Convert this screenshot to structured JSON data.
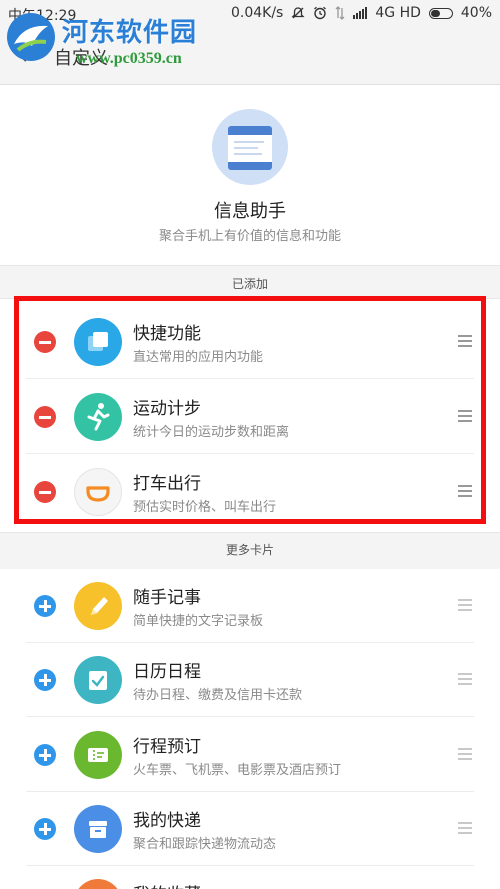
{
  "statusbar": {
    "time": "中午12:29",
    "speed": "0.04K/s",
    "network": "4G HD",
    "battery": "40%"
  },
  "watermark": {
    "name": "河东软件园",
    "url": "www.pc0359.cn"
  },
  "header": {
    "back_icon": "chevron-left-icon",
    "title": "自定义"
  },
  "hero": {
    "title": "信息助手",
    "subtitle": "聚合手机上有价值的信息和功能"
  },
  "sections": {
    "added": "已添加",
    "more": "更多卡片"
  },
  "added_items": [
    {
      "name": "快捷功能",
      "desc": "直达常用的应用内功能",
      "icon": "shortcut-icon",
      "color": "#2aa7e6"
    },
    {
      "name": "运动计步",
      "desc": "统计今日的运动步数和距离",
      "icon": "running-icon",
      "color": "#33c3a4"
    },
    {
      "name": "打车出行",
      "desc": "预估实时价格、叫车出行",
      "icon": "didi-icon",
      "color": "#f5f5f5"
    }
  ],
  "more_items": [
    {
      "name": "随手记事",
      "desc": "简单快捷的文字记录板",
      "icon": "pencil-icon",
      "color": "#f7c12b"
    },
    {
      "name": "日历日程",
      "desc": "待办日程、缴费及信用卡还款",
      "icon": "calendar-icon",
      "color": "#3eb5c2"
    },
    {
      "name": "行程预订",
      "desc": "火车票、飞机票、电影票及酒店预订",
      "icon": "ticket-icon",
      "color": "#69b82f"
    },
    {
      "name": "我的快递",
      "desc": "聚合和跟踪快递物流动态",
      "icon": "package-icon",
      "color": "#4b8ee6"
    },
    {
      "name": "我的收藏",
      "desc": "",
      "icon": "favorite-icon",
      "color": "#f07a3a"
    }
  ]
}
